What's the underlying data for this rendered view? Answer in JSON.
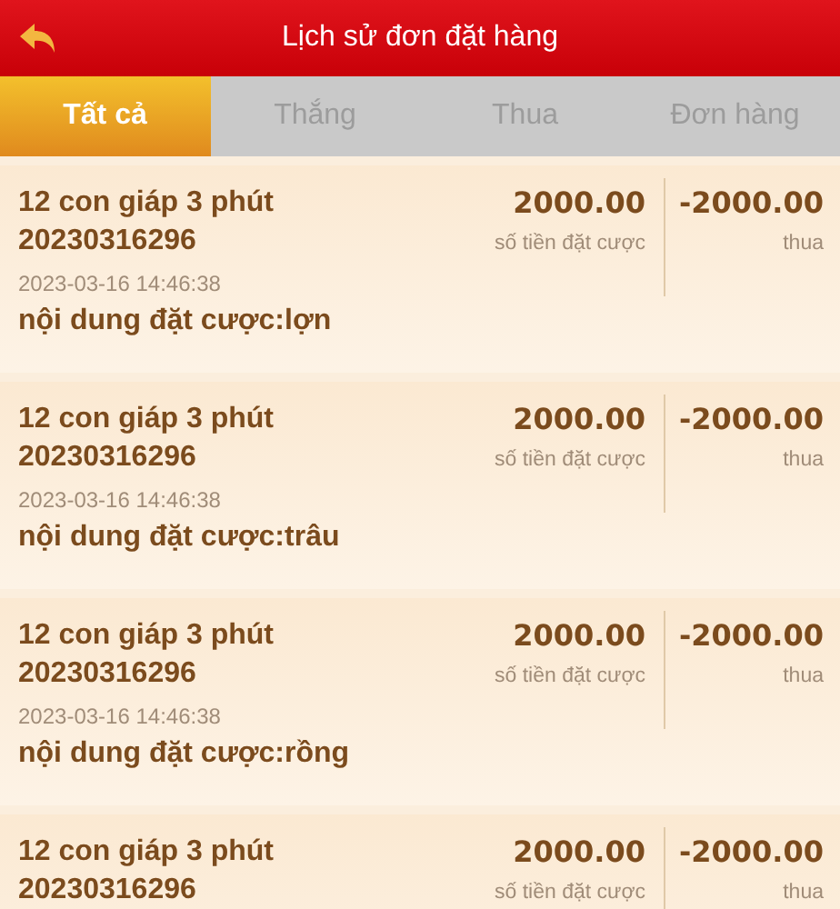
{
  "header": {
    "title": "Lịch sử đơn đặt hàng"
  },
  "tabs": [
    {
      "label": "Tất cả",
      "selected": true
    },
    {
      "label": "Thắng",
      "selected": false
    },
    {
      "label": "Thua",
      "selected": false
    },
    {
      "label": "Đơn hàng",
      "selected": false
    }
  ],
  "orders": [
    {
      "game": "12 con giáp 3 phút",
      "order_no": "20230316296",
      "time": "2023-03-16 14:46:38",
      "content": "nội dung đặt cược:lợn",
      "bet": "2000.00",
      "bet_label": "số tiền đặt cược",
      "result": "-2000.00",
      "result_label": "thua"
    },
    {
      "game": "12 con giáp 3 phút",
      "order_no": "20230316296",
      "time": "2023-03-16 14:46:38",
      "content": "nội dung đặt cược:trâu",
      "bet": "2000.00",
      "bet_label": "số tiền đặt cược",
      "result": "-2000.00",
      "result_label": "thua"
    },
    {
      "game": "12 con giáp 3 phút",
      "order_no": "20230316296",
      "time": "2023-03-16 14:46:38",
      "content": "nội dung đặt cược:rồng",
      "bet": "2000.00",
      "bet_label": "số tiền đặt cược",
      "result": "-2000.00",
      "result_label": "thua"
    },
    {
      "game": "12 con giáp 3 phút",
      "order_no": "20230316296",
      "bet": "2000.00",
      "bet_label": "số tiền đặt cược",
      "result": "-2000.00",
      "result_label": "thua"
    }
  ]
}
